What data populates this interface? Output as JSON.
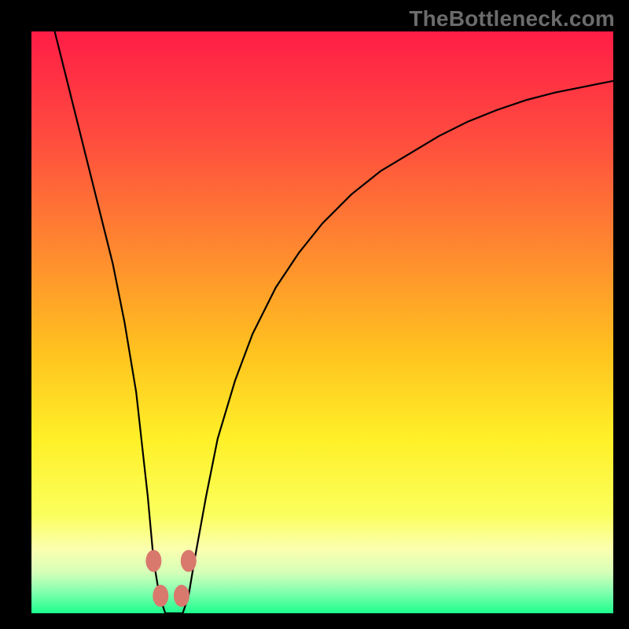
{
  "watermark": "TheBottleneck.com",
  "chart_data": {
    "type": "line",
    "title": "",
    "xlabel": "",
    "ylabel": "",
    "xlim": [
      0,
      100
    ],
    "ylim": [
      0,
      100
    ],
    "grid": false,
    "series": [
      {
        "name": "bottleneck-curve",
        "x": [
          4,
          6,
          8,
          10,
          12,
          14,
          16,
          18,
          20,
          21,
          22,
          23,
          24,
          25,
          26,
          27,
          28,
          30,
          32,
          35,
          38,
          42,
          46,
          50,
          55,
          60,
          65,
          70,
          75,
          80,
          85,
          90,
          95,
          100
        ],
        "y_pct": [
          100,
          92,
          84,
          76,
          68,
          60,
          50,
          38,
          20,
          9,
          3,
          0,
          0,
          0,
          0,
          3,
          9,
          20,
          30,
          40,
          48,
          56,
          62,
          67,
          72,
          76,
          79,
          82,
          84.5,
          86.5,
          88.2,
          89.5,
          90.5,
          91.5
        ]
      }
    ],
    "markers": {
      "name": "highlight-points",
      "color": "#d9796e",
      "points": [
        {
          "x": 21.0,
          "y_pct": 9
        },
        {
          "x": 22.2,
          "y_pct": 3
        },
        {
          "x": 25.8,
          "y_pct": 3
        },
        {
          "x": 27.0,
          "y_pct": 9
        }
      ]
    },
    "background_gradient": {
      "stops": [
        {
          "offset": 0.0,
          "color": "#ff1d46"
        },
        {
          "offset": 0.18,
          "color": "#ff4b3f"
        },
        {
          "offset": 0.38,
          "color": "#ff8a2f"
        },
        {
          "offset": 0.55,
          "color": "#ffc21f"
        },
        {
          "offset": 0.7,
          "color": "#fff028"
        },
        {
          "offset": 0.83,
          "color": "#fbff5c"
        },
        {
          "offset": 0.89,
          "color": "#fbffb0"
        },
        {
          "offset": 0.93,
          "color": "#d5ffb8"
        },
        {
          "offset": 0.96,
          "color": "#8cffb0"
        },
        {
          "offset": 1.0,
          "color": "#1dff8e"
        }
      ]
    }
  }
}
